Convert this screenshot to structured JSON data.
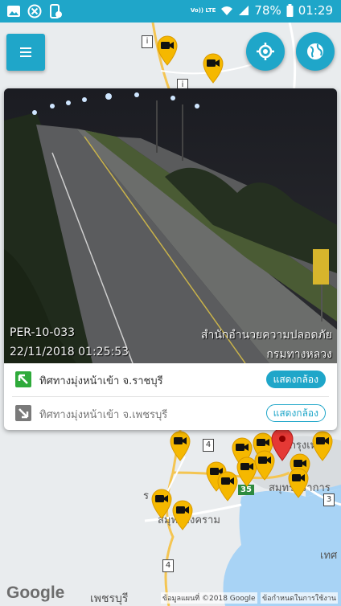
{
  "status_bar": {
    "volte": "Vo)) LTE",
    "battery": "78%",
    "time": "01:29"
  },
  "map": {
    "labels": {
      "ratchaburi_partial": "ร",
      "samut_songkhram": "สมุทรสงคราม",
      "samut_prakan": "สมุทรปราการ",
      "bangkok_partial": "กรุงเทพฯ",
      "phetchaburi": "เพชรบุรี",
      "thep_partial": "เทศ"
    },
    "shields": [
      "4",
      "35",
      "3",
      "4",
      "4"
    ],
    "google": "Google",
    "attribution_data": "ข้อมูลแผนที่ ©2018 Google",
    "attribution_terms": "ข้อกำหนดในการใช้งาน"
  },
  "camera": {
    "id": "PER-10-033",
    "datetime": "22/11/2018 01:25:53",
    "agency_line1": "สำนักอำนวยความปลอดภัย",
    "agency_line2": "กรมทางหลวง"
  },
  "directions": [
    {
      "label": "ทิศทางมุ่งหน้าเข้า จ.ราชบุรี",
      "button": "แสดงกล้อง",
      "active": true
    },
    {
      "label": "ทิศทางมุ่งหน้าเข้า จ.เพชรบุรี",
      "button": "แสดงกล้อง",
      "active": false
    }
  ],
  "icons": [
    "menu-icon",
    "my-location-icon",
    "globe-icon",
    "camera-pin-icon",
    "red-marker-icon",
    "arrow-up-left-icon",
    "arrow-down-right-icon"
  ],
  "colors": {
    "accent": "#1fa6c9",
    "pin": "#f5b800",
    "marker": "#e53935",
    "dir_green": "#2eaa3a",
    "dir_gray": "#7a7a7a"
  }
}
